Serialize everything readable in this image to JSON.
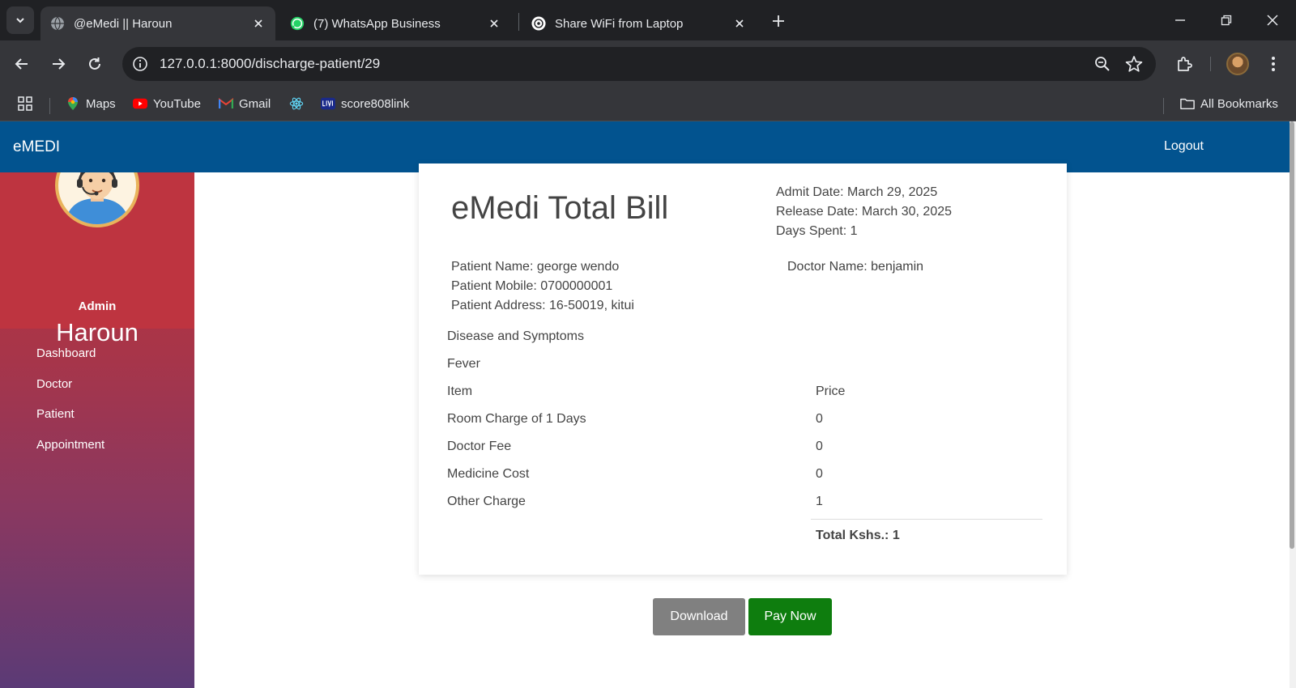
{
  "browser": {
    "tabs": [
      {
        "title": "@eMedi || Haroun",
        "icon": "globe-icon",
        "active": true
      },
      {
        "title": "(7) WhatsApp Business",
        "icon": "whatsapp-icon",
        "active": false
      },
      {
        "title": "Share WiFi from Laptop",
        "icon": "openai-icon",
        "active": false
      }
    ],
    "url": "127.0.0.1:8000/discharge-patient/29",
    "bookmarks": [
      {
        "label": "Maps",
        "icon": "maps-icon"
      },
      {
        "label": "YouTube",
        "icon": "youtube-icon"
      },
      {
        "label": "Gmail",
        "icon": "gmail-icon"
      },
      {
        "label": "",
        "icon": "react-icon"
      },
      {
        "label": "score808link",
        "icon": "live-icon"
      }
    ],
    "all_bookmarks_label": "All Bookmarks"
  },
  "navbar": {
    "brand": "eMEDI",
    "logout": "Logout",
    "color": "#02538f"
  },
  "sidebar": {
    "role": "Admin",
    "username": "Haroun",
    "items": [
      {
        "label": "Dashboard"
      },
      {
        "label": "Doctor"
      },
      {
        "label": "Patient"
      },
      {
        "label": "Appointment"
      }
    ]
  },
  "bill": {
    "title": "eMedi Total Bill",
    "admit_date": "Admit Date: March 29, 2025",
    "release_date": "Release Date: March 30, 2025",
    "days_spent": "Days Spent: 1",
    "patient_name": "Patient Name: george wendo",
    "patient_mobile": "Patient Mobile: 0700000001",
    "patient_address": "Patient Address: 16-50019, kitui",
    "doctor_name": "Doctor Name: benjamin",
    "disease_heading": "Disease and Symptoms",
    "disease": "Fever",
    "columns": {
      "item": "Item",
      "price": "Price"
    },
    "rows": [
      {
        "item": "Room Charge of 1 Days",
        "price": "0"
      },
      {
        "item": "Doctor Fee",
        "price": "0"
      },
      {
        "item": "Medicine Cost",
        "price": "0"
      },
      {
        "item": "Other Charge",
        "price": "1"
      }
    ],
    "total": "Total Kshs.: 1"
  },
  "actions": {
    "download": "Download",
    "pay_now": "Pay Now"
  }
}
